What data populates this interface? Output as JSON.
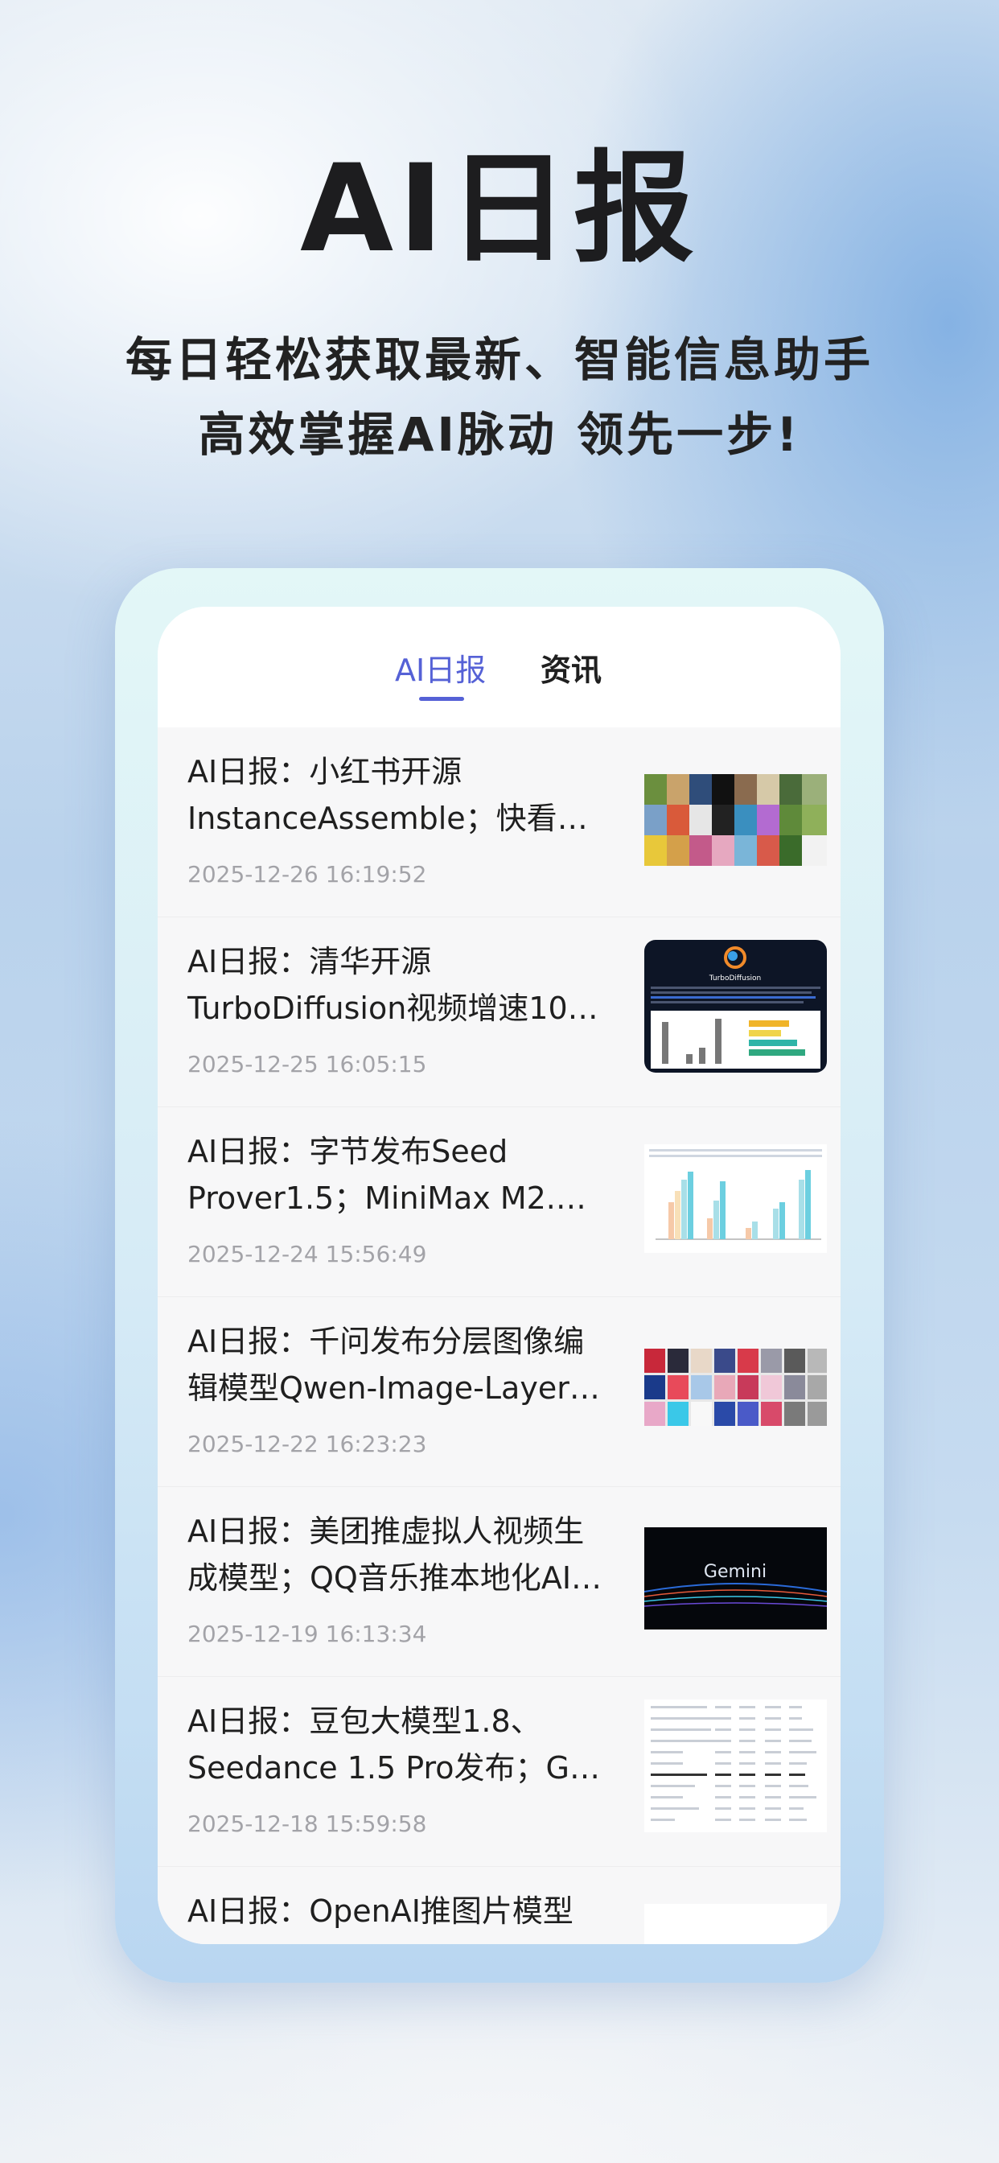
{
  "hero": {
    "title": "AI日报",
    "tagline_line1": "每日轻松获取最新、智能信息助手",
    "tagline_line2": "高效掌握AI脉动 领先一步!"
  },
  "tabs": [
    {
      "label": "AI日报",
      "active": true
    },
    {
      "label": "资讯",
      "active": false
    }
  ],
  "colors": {
    "accent": "#5561d6",
    "date_text": "#a3a3a8",
    "title_text": "#1f1f1f"
  },
  "articles": [
    {
      "title_line1": "AI日报：小红书开源",
      "title_line2": "InstanceAssemble；快看漫…",
      "date": "2025-12-26 16:19:52",
      "thumbnail": "image-collage"
    },
    {
      "title_line1": "AI日报：清华开源",
      "title_line2": "TurboDiffusion视频增速10…",
      "date": "2025-12-25 16:05:15",
      "thumbnail": "turbodiffusion-dark-card",
      "thumbnail_text": "TurboDiffusion"
    },
    {
      "title_line1": "AI日报：字节发布Seed",
      "title_line2": "Prover1.5；MiniMax M2.1…",
      "date": "2025-12-24 15:56:49",
      "thumbnail": "bar-chart-image"
    },
    {
      "title_line1": "AI日报：千问发布分层图像编",
      "title_line2": "辑模型Qwen-Image-Layer…",
      "date": "2025-12-22 16:23:23",
      "thumbnail": "image-grid"
    },
    {
      "title_line1": "AI日报：美团推虚拟人视频生",
      "title_line2": "成模型；QQ音乐推本地化AI…",
      "date": "2025-12-19 16:13:34",
      "thumbnail": "gemini-banner",
      "thumbnail_text": "Gemini"
    },
    {
      "title_line1": "AI日报：豆包大模型1.8、",
      "title_line2": "Seedance 1.5 Pro发布；Ge…",
      "date": "2025-12-18 15:59:58",
      "thumbnail": "table-image"
    },
    {
      "title_line1": "AI日报：OpenAI推图片模型",
      "title_line2": "",
      "date": "",
      "thumbnail": "blank-image"
    }
  ]
}
